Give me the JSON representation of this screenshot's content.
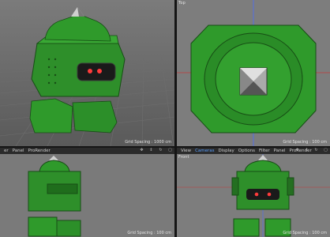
{
  "viewports": {
    "perspective": {
      "grid_spacing": "Grid Spacing : 1000 cm"
    },
    "top": {
      "label": "Top",
      "grid_spacing": "Grid Spacing : 100 cm"
    },
    "right_bottom_left": {
      "grid_spacing": "Grid Spacing : 100 cm"
    },
    "front": {
      "label": "Front",
      "grid_spacing": "Grid Spacing : 100 cm"
    }
  },
  "menus": {
    "left": [
      "er",
      "Panel",
      "ProRender"
    ],
    "right": [
      "View",
      "Cameras",
      "Display",
      "Options",
      "Filter",
      "Panel",
      "ProRender"
    ],
    "right_active_index": 1
  },
  "colors": {
    "model_green": "#2f9a2b",
    "model_dark": "#1b5e19",
    "eye_red": "#ff3b3b",
    "axis_red": "#c23b3b",
    "axis_blue": "#4a6cff",
    "grid": "#6a6a6a"
  },
  "icons": {
    "nav": [
      "move-icon",
      "zoom-icon",
      "rotate-icon",
      "maximize-icon"
    ]
  }
}
